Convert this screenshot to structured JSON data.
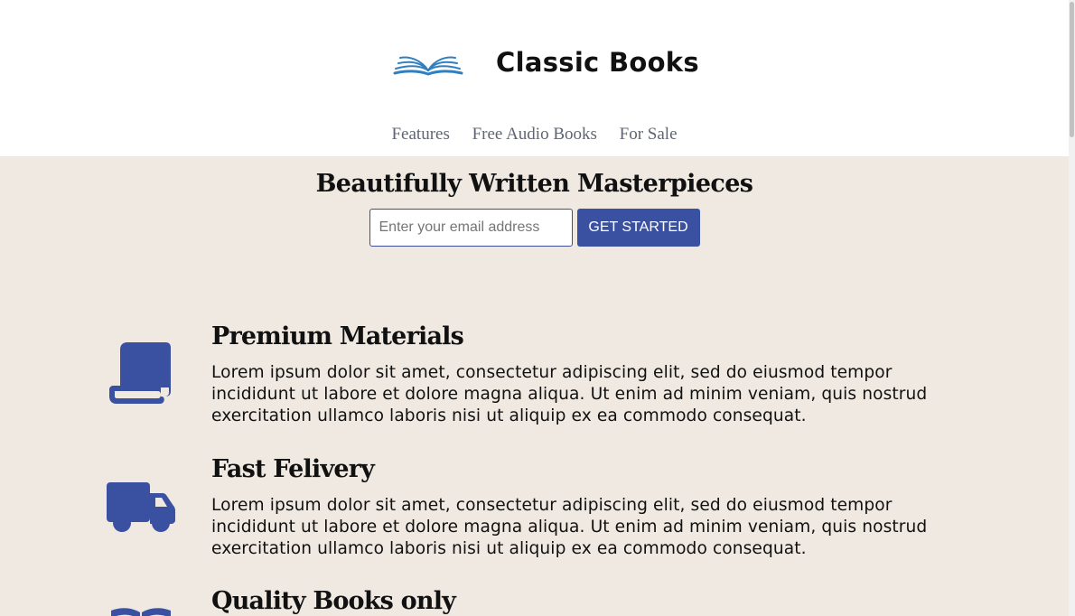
{
  "header": {
    "title": "Classic Books",
    "logo_icon": "open-book-icon",
    "nav": [
      {
        "label": "Features"
      },
      {
        "label": "Free Audio Books"
      },
      {
        "label": "For Sale"
      }
    ]
  },
  "hero": {
    "heading": "Beautifully Written Masterpieces",
    "email_placeholder": "Enter your email address",
    "email_value": "",
    "cta_label": "GET STARTED"
  },
  "features": [
    {
      "icon": "scroll-icon",
      "title": "Premium Materials",
      "body": "Lorem ipsum dolor sit amet, consectetur adipiscing elit, sed do eiusmod tempor incididunt ut labore et dolore magna aliqua. Ut enim ad minim veniam, quis nostrud exercitation ullamco laboris nisi ut aliquip ex ea commodo consequat."
    },
    {
      "icon": "truck-icon",
      "title": "Fast Felivery",
      "body": "Lorem ipsum dolor sit amet, consectetur adipiscing elit, sed do eiusmod tempor incididunt ut labore et dolore magna aliqua. Ut enim ad minim veniam, quis nostrud exercitation ullamco laboris nisi ut aliquip ex ea commodo consequat."
    },
    {
      "icon": "open-book-icon",
      "title": "Quality Books only",
      "body": ""
    }
  ],
  "colors": {
    "accent": "#3a50a0",
    "background": "#f0e9e2",
    "header_bg": "#ffffff",
    "logo": "#2f7fc1"
  }
}
